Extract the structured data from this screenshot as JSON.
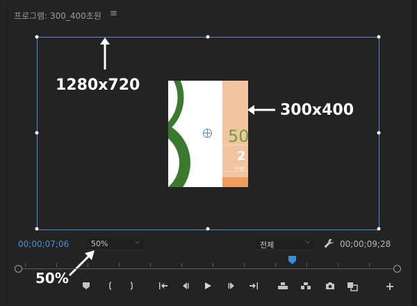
{
  "panel": {
    "title": "프로그램: 300_400초원",
    "menu_glyph": "≡"
  },
  "annotations": {
    "sequence_size": "1280x720",
    "clip_size": "300x400",
    "zoom_note": "50%"
  },
  "clip_preview": {
    "big_number": "50",
    "small_number": "2",
    "tiny_text": "hcgh"
  },
  "playback": {
    "current_timecode": "00;00;07;06",
    "duration_timecode": "00;00;09;28",
    "zoom_value": "50%",
    "resolution_value": "전체",
    "accent_color": "#4a90d9",
    "bbox_color": "#4a8ad6"
  },
  "transport": {
    "add_button_glyph": "+"
  },
  "icons": {
    "menu": "hamburger-icon",
    "wrench": "wrench-icon",
    "marker": "marker-icon",
    "mark_in": "mark-in-icon",
    "mark_out": "mark-out-icon",
    "go_to_in": "go-to-in-icon",
    "step_back": "step-back-icon",
    "play": "play-icon",
    "step_forward": "step-forward-icon",
    "go_to_out": "go-to-out-icon",
    "lift": "lift-icon",
    "extract": "extract-icon",
    "export_frame": "camera-icon",
    "comparison_view": "comparison-view-icon",
    "add": "plus-icon"
  }
}
